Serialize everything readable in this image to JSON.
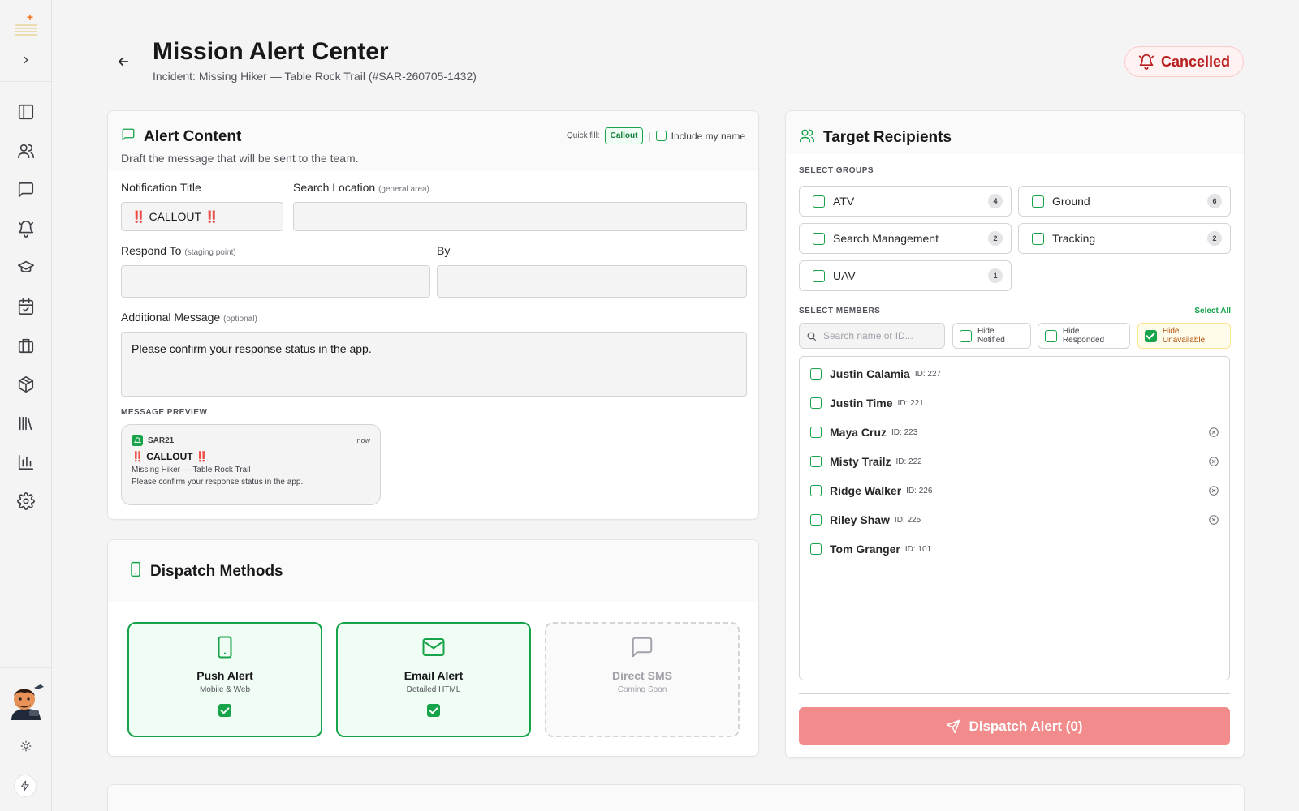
{
  "sidebar": {
    "items": [
      {
        "name": "sidebar-item-dashboard",
        "icon": "panel-icon"
      },
      {
        "name": "sidebar-item-members",
        "icon": "users-icon"
      },
      {
        "name": "sidebar-item-messages",
        "icon": "chat-icon"
      },
      {
        "name": "sidebar-item-alerts",
        "icon": "bell-icon"
      },
      {
        "name": "sidebar-item-training",
        "icon": "graduation-cap-icon"
      },
      {
        "name": "sidebar-item-calendar",
        "icon": "calendar-check-icon"
      },
      {
        "name": "sidebar-item-missions",
        "icon": "briefcase-icon"
      },
      {
        "name": "sidebar-item-inventory",
        "icon": "box-icon"
      },
      {
        "name": "sidebar-item-library",
        "icon": "library-icon"
      },
      {
        "name": "sidebar-item-reports",
        "icon": "bar-chart-icon"
      },
      {
        "name": "sidebar-item-settings",
        "icon": "gear-icon"
      }
    ]
  },
  "header": {
    "title": "Mission Alert Center",
    "subtitle": "Incident: Missing Hiker — Table Rock Trail (#SAR-260705-1432)",
    "status": "Cancelled",
    "status_color": "#b91c1c"
  },
  "alert_content": {
    "title": "Alert Content",
    "description": "Draft the message that will be sent to the team.",
    "quick_fill_label": "Quick fill:",
    "quick_fill_chip": "Callout",
    "separator": "|",
    "include_name_label": "Include my name",
    "notification_title_label": "Notification Title",
    "notification_title_mark": "‼️",
    "notification_title_value": "CALLOUT",
    "search_location_label": "Search Location",
    "search_location_hint": "(general area)",
    "search_location_value": "",
    "respond_to_label": "Respond To",
    "respond_to_hint": "(staging point)",
    "respond_to_value": "",
    "by_label": "By",
    "by_value": "",
    "additional_label": "Additional Message",
    "additional_hint": "(optional)",
    "additional_value": "Please confirm your response status in the app.",
    "preview_label": "MESSAGE PREVIEW",
    "preview": {
      "app": "SAR21",
      "time": "now",
      "title": "CALLOUT",
      "line1": "Missing Hiker — Table Rock Trail",
      "line2": "Please confirm your response status in the app."
    }
  },
  "dispatch_methods": {
    "title": "Dispatch Methods",
    "methods": [
      {
        "title": "Push Alert",
        "subtitle": "Mobile & Web",
        "checked": true
      },
      {
        "title": "Email Alert",
        "subtitle": "Detailed HTML",
        "checked": true
      },
      {
        "title": "Direct SMS",
        "subtitle": "Coming Soon",
        "checked": false
      }
    ]
  },
  "recipients": {
    "title": "Target Recipients",
    "groups_label": "SELECT GROUPS",
    "groups": [
      {
        "label": "ATV",
        "count": "4"
      },
      {
        "label": "Ground",
        "count": "6"
      },
      {
        "label": "Search Management",
        "count": "2"
      },
      {
        "label": "Tracking",
        "count": "2"
      },
      {
        "label": "UAV",
        "count": "1"
      }
    ],
    "members_label": "SELECT MEMBERS",
    "select_all": "Select All",
    "search_placeholder": "Search name or ID...",
    "filters": [
      {
        "label": "Hide Notified",
        "checked": false
      },
      {
        "label": "Hide Responded",
        "checked": false
      },
      {
        "label": "Hide Unavailable",
        "checked": true
      }
    ],
    "members": [
      {
        "name": "Justin Calamia",
        "id": "ID: 227",
        "removable": false
      },
      {
        "name": "Justin Time",
        "id": "ID: 221",
        "removable": false
      },
      {
        "name": "Maya Cruz",
        "id": "ID: 223",
        "removable": true
      },
      {
        "name": "Misty Trailz",
        "id": "ID: 222",
        "removable": true
      },
      {
        "name": "Ridge Walker",
        "id": "ID: 226",
        "removable": true
      },
      {
        "name": "Riley Shaw",
        "id": "ID: 225",
        "removable": true
      },
      {
        "name": "Tom Granger",
        "id": "ID: 101",
        "removable": false
      }
    ],
    "dispatch_button": "Dispatch Alert (0)"
  },
  "colors": {
    "accent": "#16a34a",
    "danger": "#dc2626",
    "dispatch_button": "#f28b8b"
  }
}
